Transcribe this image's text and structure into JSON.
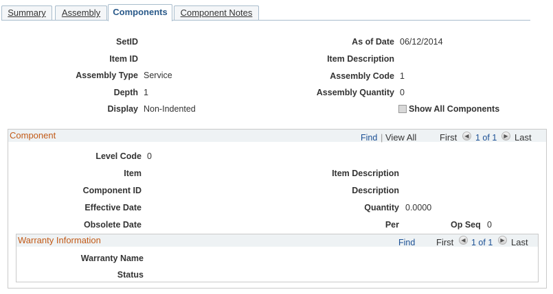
{
  "tabs": [
    {
      "label": "Summary"
    },
    {
      "label": "Assembly"
    },
    {
      "label": "Components"
    },
    {
      "label": "Component Notes"
    }
  ],
  "header": {
    "setid_label": "SetID",
    "setid_value": "",
    "itemid_label": "Item ID",
    "itemid_value": "",
    "assembly_type_label": "Assembly Type",
    "assembly_type_value": "Service",
    "depth_label": "Depth",
    "depth_value": "1",
    "display_label": "Display",
    "display_value": "Non-Indented",
    "as_of_date_label": "As of Date",
    "as_of_date_value": "06/12/2014",
    "item_description_label": "Item Description",
    "assembly_code_label": "Assembly Code",
    "assembly_code_value": "1",
    "assembly_quantity_label": "Assembly Quantity",
    "assembly_quantity_value": "0",
    "show_all_label": "Show All Components",
    "show_all_checked": false
  },
  "component": {
    "title": "Component",
    "find": "Find",
    "separator": "|",
    "view_all": "View All",
    "first": "First",
    "page": "1 of 1",
    "last": "Last",
    "level_code_label": "Level Code",
    "level_code_value": "0",
    "item_label": "Item",
    "item_description_label": "Item Description",
    "component_id_label": "Component ID",
    "description_label": "Description",
    "effective_date_label": "Effective Date",
    "quantity_label": "Quantity",
    "quantity_value": "0.0000",
    "obsolete_date_label": "Obsolete Date",
    "per_label": "Per",
    "op_seq_label": "Op Seq",
    "op_seq_value": "0"
  },
  "warranty": {
    "title": "Warranty Information",
    "find": "Find",
    "first": "First",
    "page": "1 of 1",
    "last": "Last",
    "name_label": "Warranty Name",
    "status_label": "Status"
  }
}
